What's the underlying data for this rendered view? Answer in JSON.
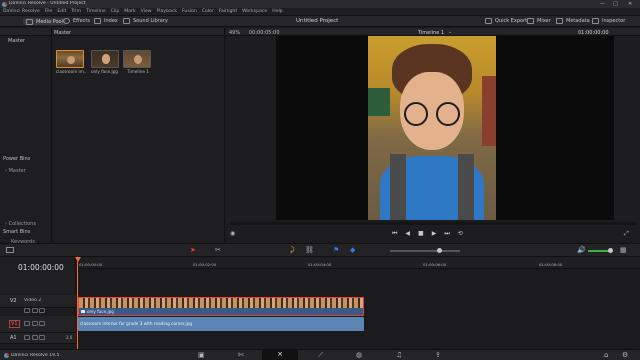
{
  "window": {
    "title": "DaVinci Resolve - Untitled Project",
    "controls": [
      "—",
      "□",
      "✕"
    ]
  },
  "menu": [
    "DaVinci Resolve",
    "File",
    "Edit",
    "Trim",
    "Timeline",
    "Clip",
    "Mark",
    "View",
    "Playback",
    "Fusion",
    "Color",
    "Fairlight",
    "Workspace",
    "Help"
  ],
  "toolbar": {
    "media_pool": "Media Pool",
    "effects": "Effects",
    "index": "Index",
    "sound_library": "Sound Library",
    "project_title": "Untitled Project",
    "quick_export": "Quick Export",
    "mixer": "Mixer",
    "metadata": "Metadata",
    "inspector": "Inspector"
  },
  "left_panel": {
    "master_header": "Master",
    "power_bins": "Power Bins",
    "power_bins_master": "Master",
    "smart_bins": "Smart Bins",
    "keywords": "Keywords",
    "collections": "Collections"
  },
  "media_pool": {
    "header": "Master",
    "clips": [
      {
        "label": "classroom im..."
      },
      {
        "label": "only face.jpg"
      },
      {
        "label": "Timeline 1"
      }
    ]
  },
  "viewer": {
    "zoom": "49%",
    "source_tc": "00:00:05:00",
    "timeline_name": "Timeline 1",
    "record_tc": "01:00:00:00"
  },
  "timeline": {
    "timecode": "01:00:00:00",
    "ruler": [
      "01:00:00:00",
      "01:00:02:00",
      "01:00:04:00",
      "01:00:06:00",
      "01:00:08:00"
    ],
    "tracks": {
      "v2_label": "V2",
      "v2_name": "Video 2",
      "v1_label": "V1",
      "a1_label": "A1",
      "a1_level": "2.0"
    },
    "clip_v2": "only face.jpg",
    "clip_v1": "classroom interior for grade 3 with reading corner.jpg"
  },
  "bottom": {
    "app_version": "DaVinci Resolve 19.5"
  },
  "colors": {
    "accent_red": "#e0443a",
    "clip_blue": "#5b86b3",
    "playhead": "#ff6633"
  }
}
